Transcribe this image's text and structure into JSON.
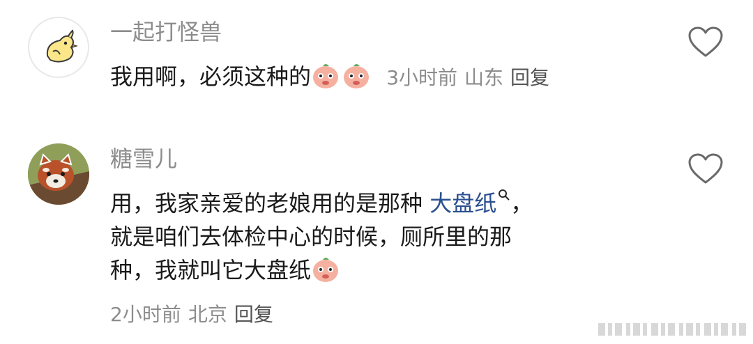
{
  "comments": [
    {
      "username": "一起打怪兽",
      "text_before_emoji": "我用啊，必须这种的",
      "time": "3小时前",
      "location": "山东",
      "reply": "回复",
      "avatar_icon": "chick-avatar",
      "emoji_icon": "peach-face-emoji"
    },
    {
      "username": "糖雪儿",
      "line1_prefix": "用，我家亲爱的老娘用的是那种",
      "line1_link": "大盘纸",
      "line1_suffix": "，",
      "line2": "就是咱们去体检中心的时候，厕所里的那",
      "line3": "种，我就叫它大盘纸",
      "time": "2小时前",
      "location": "北京",
      "reply": "回复",
      "avatar_icon": "red-panda-avatar",
      "emoji_icon": "peach-face-emoji"
    }
  ],
  "colors": {
    "username": "#8c8c8c",
    "text": "#1a1a1a",
    "link": "#2a4f8f",
    "meta": "#8c8c8c"
  }
}
